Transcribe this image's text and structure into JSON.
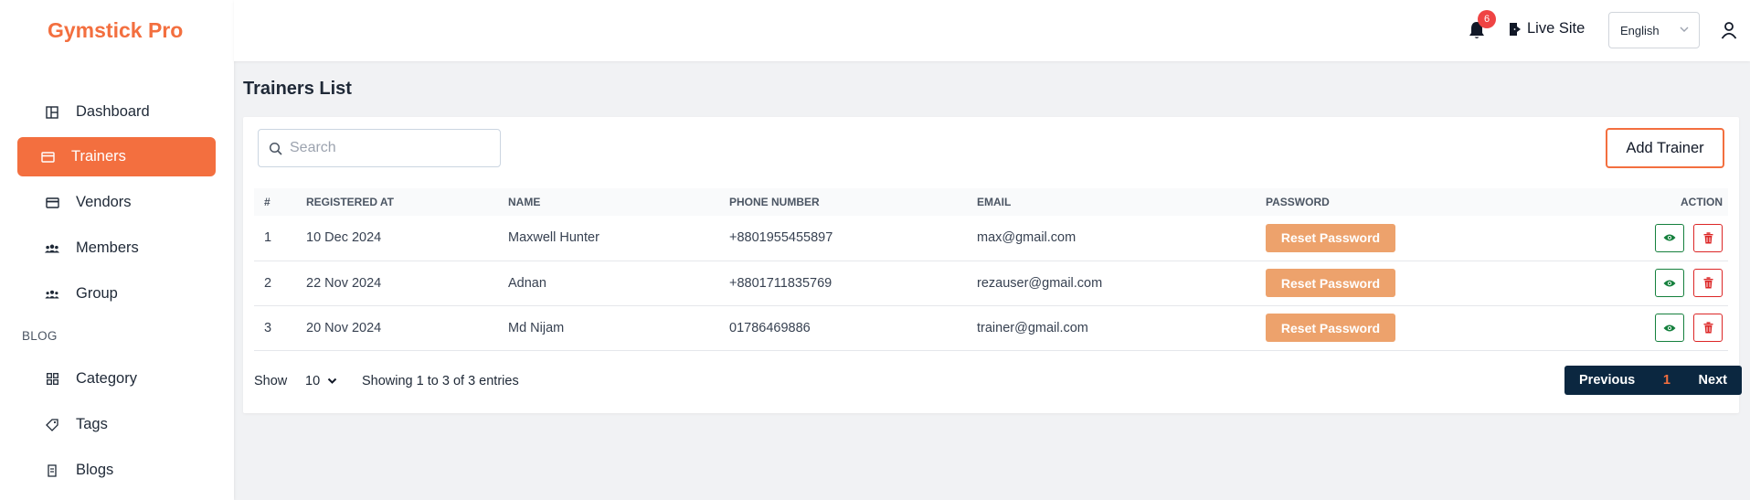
{
  "app": {
    "title": "Gymstick Pro"
  },
  "sidebar": {
    "items": [
      {
        "label": "Dashboard",
        "icon": "dashboard-icon"
      },
      {
        "label": "Trainers",
        "icon": "card-icon",
        "active": true
      },
      {
        "label": "Vendors",
        "icon": "card-icon"
      },
      {
        "label": "Members",
        "icon": "members-icon"
      },
      {
        "label": "Group",
        "icon": "group-icon"
      }
    ],
    "section_label": "BLOG",
    "blog_items": [
      {
        "label": "Category",
        "icon": "grid-icon"
      },
      {
        "label": "Tags",
        "icon": "tag-icon"
      },
      {
        "label": "Blogs",
        "icon": "document-icon"
      }
    ]
  },
  "header": {
    "notification_count": "6",
    "live_site_label": "Live Site",
    "language": "English"
  },
  "page": {
    "title": "Trainers List"
  },
  "search": {
    "placeholder": "Search"
  },
  "toolbar": {
    "add_label": "Add Trainer"
  },
  "table": {
    "columns": [
      "#",
      "REGISTERED AT",
      "NAME",
      "PHONE NUMBER",
      "EMAIL",
      "PASSWORD",
      "ACTION"
    ],
    "rows": [
      {
        "index": "1",
        "registered_at": "10 Dec 2024",
        "name": "Maxwell Hunter",
        "phone": "+8801955455897",
        "email": "max@gmail.com",
        "password_action": "Reset Password"
      },
      {
        "index": "2",
        "registered_at": "22 Nov 2024",
        "name": "Adnan",
        "phone": "+8801711835769",
        "email": "rezauser@gmail.com",
        "password_action": "Reset Password"
      },
      {
        "index": "3",
        "registered_at": "20 Nov 2024",
        "name": "Md Nijam",
        "phone": "01786469886",
        "email": "trainer@gmail.com",
        "password_action": "Reset Password"
      }
    ]
  },
  "footer": {
    "show_label": "Show",
    "page_size": "10",
    "entries_text": "Showing 1 to 3 of 3 entries",
    "prev_label": "Previous",
    "current_page": "1",
    "next_label": "Next"
  },
  "colors": {
    "accent": "#f36f3f",
    "reset_button": "#eda26c",
    "pager_bg": "#0b2740",
    "badge": "#ef4444",
    "view": "#15803d",
    "delete": "#dc2626"
  }
}
